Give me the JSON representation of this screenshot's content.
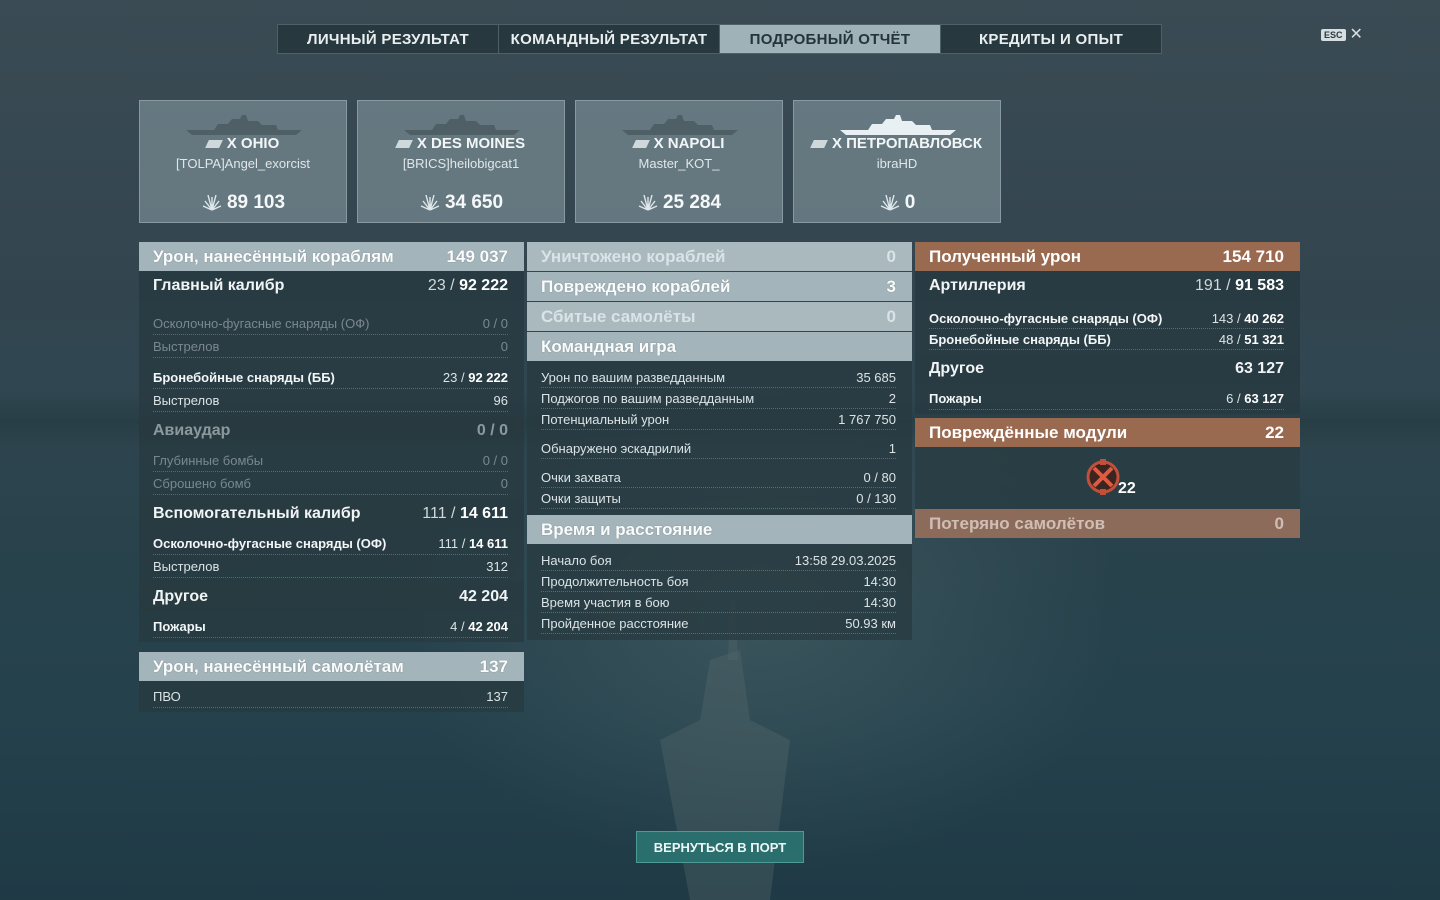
{
  "tabs": [
    "ЛИЧНЫЙ РЕЗУЛЬТАТ",
    "КОМАНДНЫЙ РЕЗУЛЬТАТ",
    "ПОДРОБНЫЙ ОТЧЁТ",
    "КРЕДИТЫ И ОПЫТ"
  ],
  "active_tab": "ПОДРОБНЫЙ ОТЧЁТ",
  "esc": {
    "key": "ESC",
    "close": "✕"
  },
  "players": [
    {
      "ship": "X OHIO",
      "player": "[TOLPA]Angel_exorcist",
      "score": "89 103"
    },
    {
      "ship": "X DES MOINES",
      "player": "[BRICS]heilobigcat1",
      "score": "34 650"
    },
    {
      "ship": "X NAPOLI",
      "player": "Master_KOT_",
      "score": "25 284"
    },
    {
      "ship": "X ПЕТРОПАВЛОВСК",
      "player": "ibraHD",
      "score": "0"
    }
  ],
  "left": {
    "damage_header": {
      "label": "Урон, нанесённый кораблям",
      "value": "149 037"
    },
    "main_caliber": {
      "label": "Главный калибр",
      "hits": "23",
      "value": "92 222"
    },
    "mc_rows": [
      {
        "label": "Осколочно-фугасные снаряды (ОФ)",
        "hits": "0",
        "value": "0"
      },
      {
        "label": "Выстрелов",
        "value": "0"
      },
      {
        "label": "Бронебойные снаряды (ББ)",
        "hits": "23",
        "value": "92 222"
      },
      {
        "label": "Выстрелов",
        "value": "96"
      }
    ],
    "airstrike": {
      "label": "Авиаудар",
      "value": "0 / 0"
    },
    "airstrike_rows": [
      {
        "label": "Глубинные бомбы",
        "value": "0 / 0"
      },
      {
        "label": "Сброшено бомб",
        "value": "0"
      }
    ],
    "secondary": {
      "label": "Вспомогательный калибр",
      "hits": "111",
      "value": "14 611"
    },
    "sec_rows": [
      {
        "label": "Осколочно-фугасные снаряды (ОФ)",
        "hits": "111",
        "value": "14 611"
      },
      {
        "label": "Выстрелов",
        "value": "312"
      }
    ],
    "other": {
      "label": "Другое",
      "value": "42 204"
    },
    "other_rows": [
      {
        "label": "Пожары",
        "hits": "4",
        "value": "42 204"
      }
    ],
    "planes_header": {
      "label": "Урон, нанесённый самолётам",
      "value": "137"
    },
    "planes_rows": [
      {
        "label": "ПВО",
        "value": "137"
      }
    ]
  },
  "middle": {
    "destroyed": {
      "label": "Уничтожено кораблей",
      "value": "0"
    },
    "damaged": {
      "label": "Повреждено кораблей",
      "value": "3"
    },
    "planes_shot": {
      "label": "Сбитые самолёты",
      "value": "0"
    },
    "team_header": "Командная игра",
    "team_rows": [
      {
        "label": "Урон по вашим разведданным",
        "value": "35 685"
      },
      {
        "label": "Поджогов по вашим разведданным",
        "value": "2"
      },
      {
        "label": "Потенциальный урон",
        "value": "1 767 750"
      },
      {
        "label": "Обнаружено эскадрилий",
        "value": "1"
      },
      {
        "label": "Очки захвата",
        "value": "0 / 80"
      },
      {
        "label": "Очки защиты",
        "value": "0 / 130"
      }
    ],
    "time_header": "Время и расстояние",
    "time_rows": [
      {
        "label": "Начало боя",
        "value": "13:58  29.03.2025"
      },
      {
        "label": "Продолжительность боя",
        "value": "14:30"
      },
      {
        "label": "Время участия в бою",
        "value": "14:30"
      },
      {
        "label": "Пройденное расстояние",
        "value": "50.93 км"
      }
    ]
  },
  "right": {
    "received": {
      "label": "Полученный урон",
      "value": "154 710"
    },
    "artillery": {
      "label": "Артиллерия",
      "hits": "191",
      "value": "91 583"
    },
    "art_rows": [
      {
        "label": "Осколочно-фугасные снаряды (ОФ)",
        "hits": "143",
        "value": "40 262"
      },
      {
        "label": "Бронебойные снаряды (ББ)",
        "hits": "48",
        "value": "51 321"
      }
    ],
    "other": {
      "label": "Другое",
      "value": "63 127"
    },
    "other_rows": [
      {
        "label": "Пожары",
        "hits": "6",
        "value": "63 127"
      }
    ],
    "modules": {
      "label": "Повреждённые модули",
      "value": "22",
      "count": "22"
    },
    "lost_planes": {
      "label": "Потеряно самолётов",
      "value": "0"
    }
  },
  "return_button": "ВЕРНУТЬСЯ В ПОРТ"
}
